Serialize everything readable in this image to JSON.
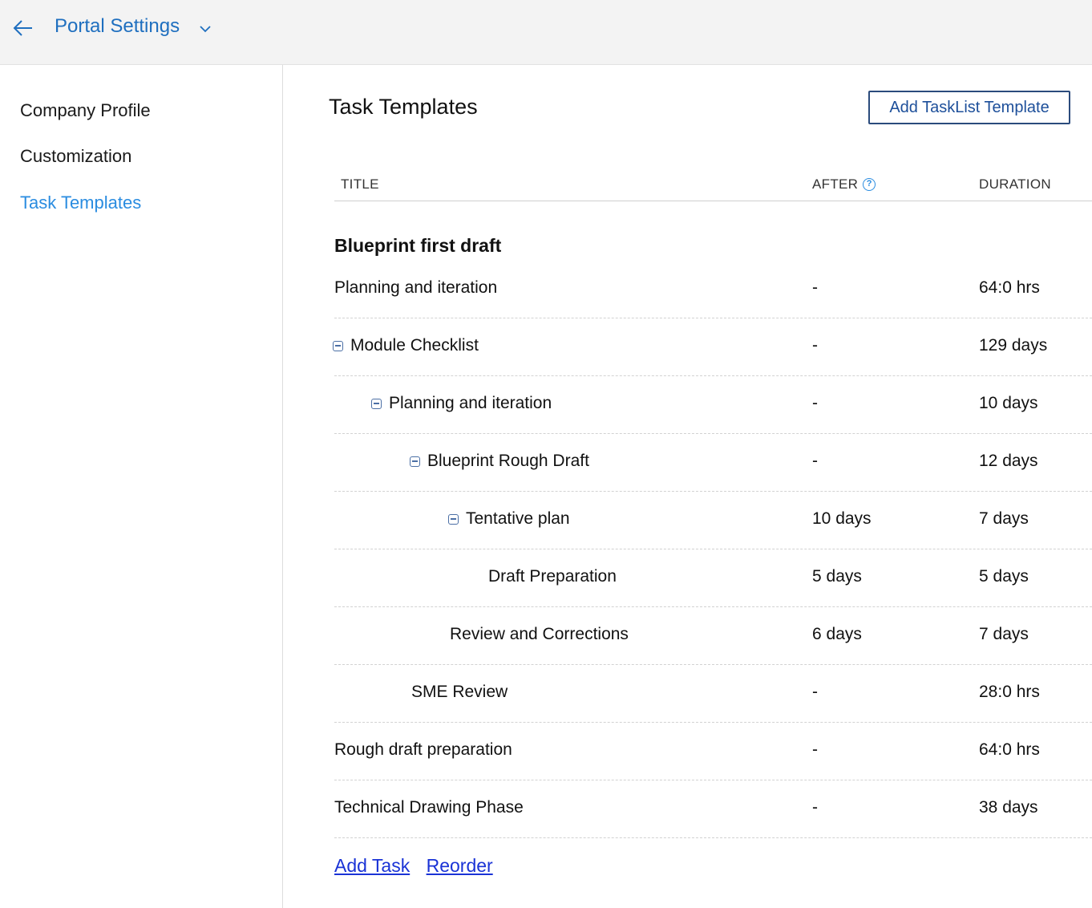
{
  "header": {
    "title": "Portal Settings",
    "back_icon": "arrow-left-icon",
    "dropdown_icon": "chevron-down-icon",
    "accent": "#1f6fbf"
  },
  "sidebar": {
    "items": [
      {
        "label": "Company Profile",
        "active": false
      },
      {
        "label": "Customization",
        "active": false
      },
      {
        "label": "Task Templates",
        "active": true
      }
    ],
    "active_color": "#2a8ce0"
  },
  "main": {
    "title": "Task Templates",
    "add_button": "Add TaskList Template",
    "columns": {
      "title": "TITLE",
      "after": "AFTER",
      "duration": "DURATION"
    },
    "help_icon": "question-circle-icon",
    "group": "Blueprint first draft",
    "rows": [
      {
        "title": "Planning and iteration",
        "after": "-",
        "duration": "64:0 hrs",
        "collapsible": false
      },
      {
        "title": "Module Checklist",
        "after": "-",
        "duration": "129 days",
        "collapsible": true
      },
      {
        "title": "Planning and iteration",
        "after": "-",
        "duration": "10 days",
        "collapsible": true
      },
      {
        "title": "Blueprint Rough Draft",
        "after": "-",
        "duration": "12 days",
        "collapsible": true
      },
      {
        "title": "Tentative plan",
        "after": "10 days",
        "duration": "7 days",
        "collapsible": true
      },
      {
        "title": "Draft Preparation",
        "after": "5 days",
        "duration": "5 days",
        "collapsible": false
      },
      {
        "title": "Review and Corrections",
        "after": "6 days",
        "duration": "7 days",
        "collapsible": false
      },
      {
        "title": "SME Review",
        "after": "-",
        "duration": "28:0 hrs",
        "collapsible": false
      },
      {
        "title": "Rough draft preparation",
        "after": "-",
        "duration": "64:0 hrs",
        "collapsible": false
      },
      {
        "title": "Technical Drawing Phase",
        "after": "-",
        "duration": "38 days",
        "collapsible": false
      }
    ],
    "footer": {
      "add_task": "Add Task",
      "reorder": "Reorder"
    }
  }
}
